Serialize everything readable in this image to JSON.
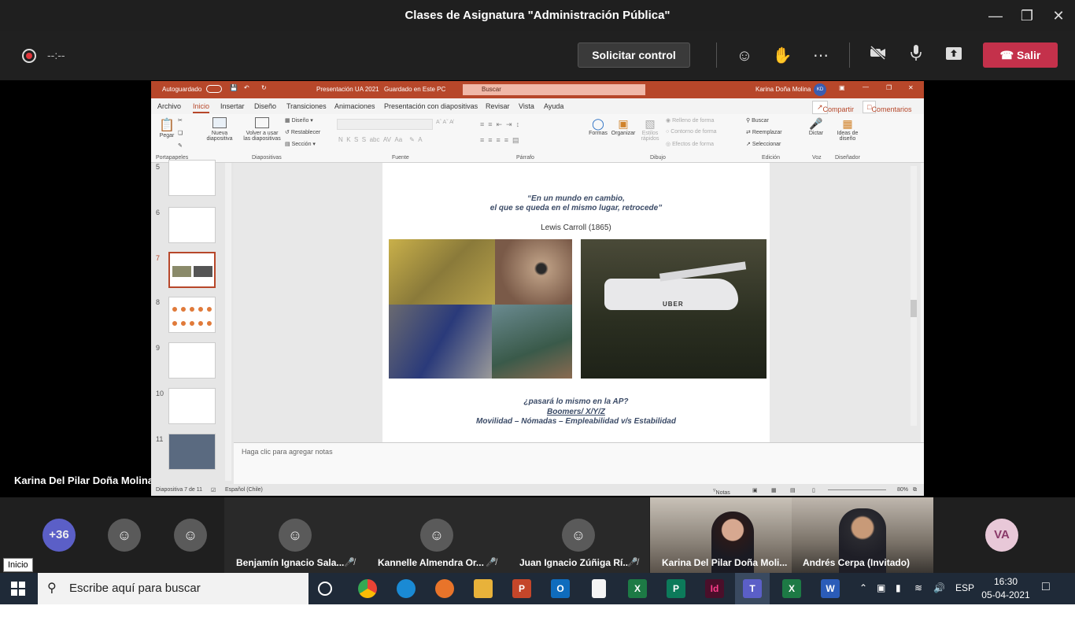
{
  "window": {
    "title": "Clases de Asignatura \"Administración Pública\""
  },
  "meeting": {
    "timer": "--:--",
    "request_control": "Solicitar control",
    "leave": "Salir",
    "presenter": "Karina Del Pilar Doña Molina"
  },
  "ppt": {
    "autosave": "Autoguardado",
    "doc_title": "Presentación UA 2021",
    "saved_status": "Guardado en Este PC",
    "search_placeholder": "Buscar",
    "user": "Karina Doña Molina",
    "user_initials": "KD",
    "tabs": [
      "Archivo",
      "Inicio",
      "Insertar",
      "Diseño",
      "Transiciones",
      "Animaciones",
      "Presentación con diapositivas",
      "Revisar",
      "Vista",
      "Ayuda"
    ],
    "share": "Compartir",
    "comments": "Comentarios",
    "ribbon": {
      "paste": "Pegar",
      "new_slide_1": "Nueva",
      "new_slide_2": "diapositiva",
      "reuse_1": "Volver a usar",
      "reuse_2": "las diapositivas",
      "layout": "Diseño",
      "reset": "Restablecer",
      "section": "Sección",
      "shapes": "Formas",
      "arrange": "Organizar",
      "quick_styles_1": "Estilos",
      "quick_styles_2": "rápidos",
      "shape_fill": "Relleno de forma",
      "shape_outline": "Contorno de forma",
      "shape_effects": "Efectos de forma",
      "find": "Buscar",
      "replace": "Reemplazar",
      "select": "Seleccionar",
      "dictate": "Dictar",
      "design_ideas_1": "Ideas de",
      "design_ideas_2": "diseño",
      "groups": [
        "Portapapeles",
        "Diapositivas",
        "Fuente",
        "Párrafo",
        "Dibujo",
        "Edición",
        "Voz",
        "Diseñador"
      ]
    },
    "thumbnails": [
      "5",
      "6",
      "7",
      "8",
      "9",
      "10",
      "11"
    ],
    "slide": {
      "quote_line1": "“En un mundo en cambio,",
      "quote_line2": "el que se queda en el mismo lugar, retrocede”",
      "author": "Lewis Carroll (1865)",
      "uber_label": "UBER",
      "q1": "¿pasará lo mismo en la AP?",
      "q2": "Boomers/ X/Y/Z",
      "q3": "Movilidad – Nómadas – Empleabilidad  v/s Estabilidad"
    },
    "notes_placeholder": "Haga clic para agregar notas",
    "status_slide": "Diapositiva 7 de 11",
    "status_lang": "Español (Chile)",
    "status_notes": "Notas",
    "zoom": "80%"
  },
  "participants": {
    "overflow": "+36",
    "named": [
      "Benjamín Ignacio Sala...",
      "Kannelle Almendra Or...",
      "Juan Ignacio Zúñiga Rí..."
    ],
    "video_1": "Karina Del Pilar Doña Moli...",
    "video_2": "Andrés Cerpa (Invitado)",
    "initials": "VA"
  },
  "taskbar": {
    "tooltip": "Inicio",
    "search": "Escribe aquí para buscar",
    "lang": "ESP",
    "time": "16:30",
    "date": "05-04-2021"
  }
}
